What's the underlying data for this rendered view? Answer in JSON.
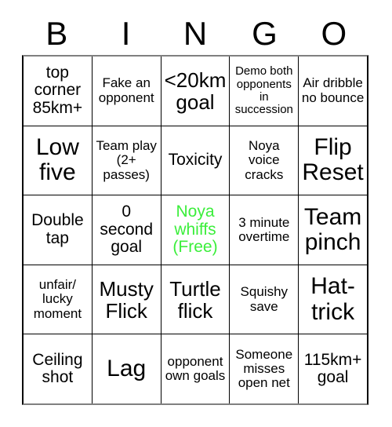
{
  "card": {
    "header_letters": [
      "B",
      "I",
      "N",
      "G",
      "O"
    ],
    "free_color": "#3bee3b",
    "text_color": "#000000",
    "grid_line_color": "#000000",
    "rows": [
      [
        {
          "text": "top corner 85km+",
          "size": "md",
          "free": false
        },
        {
          "text": "Fake an opponent",
          "size": "sm",
          "free": false
        },
        {
          "text": "<20km goal",
          "size": "lg",
          "free": false
        },
        {
          "text": "Demo both opponents in succession",
          "size": "xs",
          "free": false
        },
        {
          "text": "Air dribble no bounce",
          "size": "sm",
          "free": false
        }
      ],
      [
        {
          "text": "Low five",
          "size": "xl",
          "free": false
        },
        {
          "text": "Team play (2+ passes)",
          "size": "sm",
          "free": false
        },
        {
          "text": "Toxicity",
          "size": "md",
          "free": false
        },
        {
          "text": "Noya voice cracks",
          "size": "sm",
          "free": false
        },
        {
          "text": "Flip Reset",
          "size": "xl",
          "free": false
        }
      ],
      [
        {
          "text": "Double tap",
          "size": "md",
          "free": false
        },
        {
          "text": "0 second goal",
          "size": "md",
          "free": false
        },
        {
          "text": "Noya whiffs (Free)",
          "size": "md",
          "free": true
        },
        {
          "text": "3 minute overtime",
          "size": "sm",
          "free": false
        },
        {
          "text": "Team pinch",
          "size": "xl",
          "free": false
        }
      ],
      [
        {
          "text": "unfair/ lucky moment",
          "size": "sm",
          "free": false
        },
        {
          "text": "Musty Flick",
          "size": "lg",
          "free": false
        },
        {
          "text": "Turtle flick",
          "size": "lg",
          "free": false
        },
        {
          "text": "Squishy save",
          "size": "sm",
          "free": false
        },
        {
          "text": "Hat-trick",
          "size": "xl",
          "free": false
        }
      ],
      [
        {
          "text": "Ceiling shot",
          "size": "md",
          "free": false
        },
        {
          "text": "Lag",
          "size": "xl",
          "free": false
        },
        {
          "text": "opponent own goals",
          "size": "sm",
          "free": false
        },
        {
          "text": "Someone misses open net",
          "size": "sm",
          "free": false
        },
        {
          "text": "115km+ goal",
          "size": "md",
          "free": false
        }
      ]
    ]
  }
}
